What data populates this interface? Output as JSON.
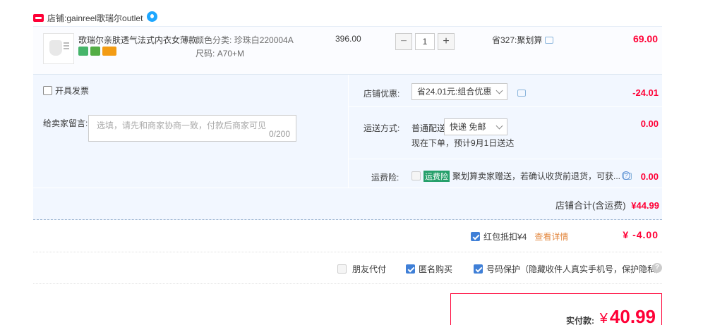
{
  "shop": {
    "label": "店铺:",
    "name": "gainreel歌瑞尔outlet"
  },
  "product": {
    "title": "歌瑞尔亲肤透气法式内衣女薄款...",
    "color_label": "颜色分类:",
    "color_value": "珍珠白220004A",
    "size_label": "尺码:",
    "size_value": "A70+M",
    "price": "396.00",
    "quantity": "1",
    "qty_minus": "−",
    "qty_plus": "+",
    "promo": "省327:聚划算",
    "row_total": "69.00"
  },
  "invoice": {
    "label": "开具发票"
  },
  "message": {
    "label": "给卖家留言:",
    "placeholder": "选填，请先和商家协商一致，付款后商家可见",
    "count": "0/200"
  },
  "shop_discount": {
    "label": "店铺优惠:",
    "selected": "省24.01元:组合优惠",
    "amount": "-24.01"
  },
  "shipping": {
    "label": "运送方式:",
    "type": "普通配送",
    "selected": "快递 免邮",
    "note": "现在下单，预计9月1日送达",
    "amount": "0.00"
  },
  "insurance": {
    "label": "运费险:",
    "tag": "运费险",
    "text": "聚划算卖家赠送，若确认收货前退货，可获...",
    "amount": "0.00"
  },
  "shop_total": {
    "label": "店铺合计(含运费)",
    "amount": "¥44.99"
  },
  "redpacket": {
    "label": "红包抵扣¥4",
    "detail_link": "查看详情",
    "amount": "¥ -4.00"
  },
  "options": {
    "friend_pay": "朋友代付",
    "anonymous": "匿名购买",
    "number_protect": "号码保护（隐藏收件人真实手机号，保护隐私）"
  },
  "payment": {
    "label": "实付款:",
    "currency": "¥",
    "amount": "40.99"
  },
  "colors": {
    "accent_red": "#ff0036",
    "panel_blue": "#f2f7ff",
    "checkbox_blue": "#3f7fd7"
  }
}
